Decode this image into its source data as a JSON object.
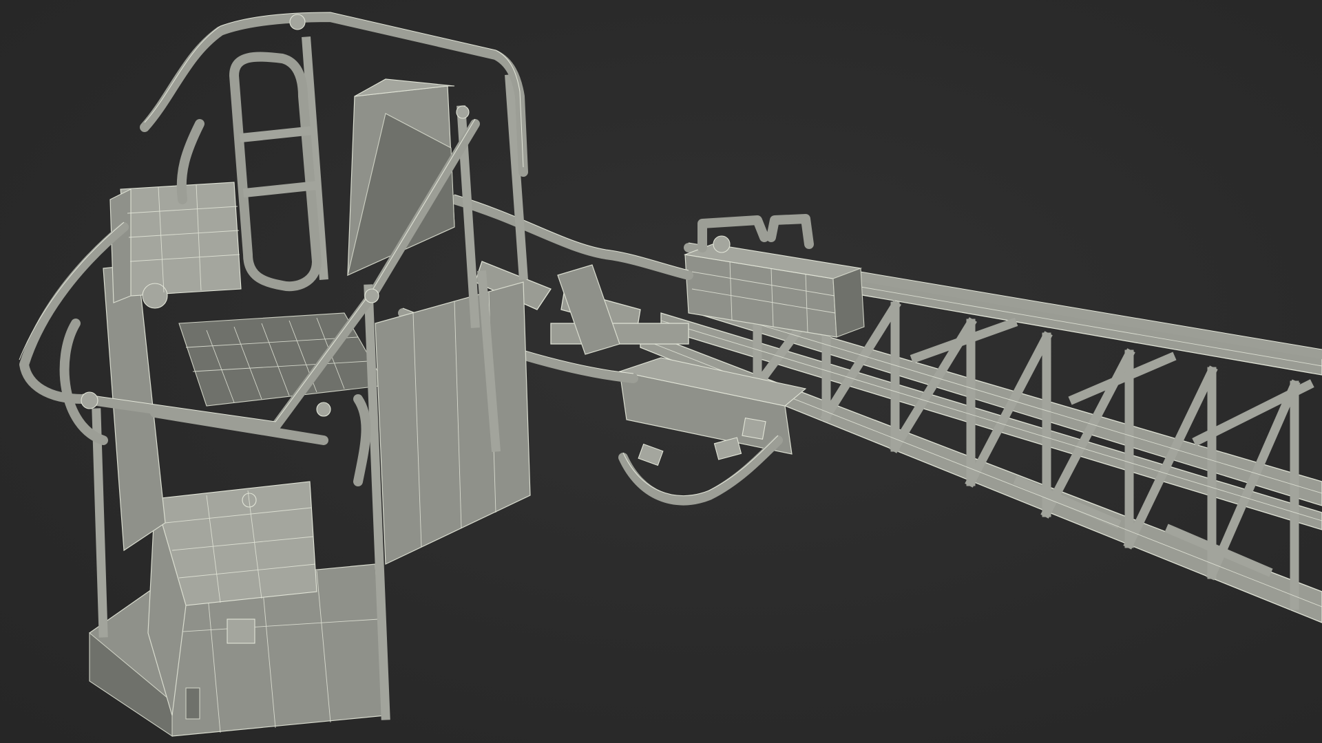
{
  "scene": {
    "subject": "",
    "background_color": "#2b2b2b",
    "model_color": "#9a9c94",
    "wireframe_color": "#e4e7da"
  }
}
